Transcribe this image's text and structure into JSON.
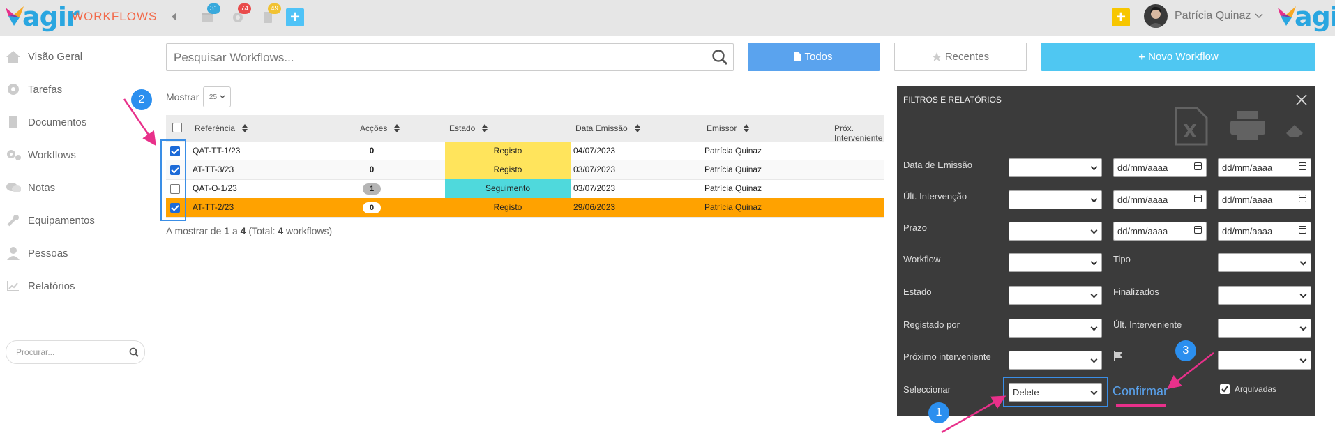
{
  "header": {
    "app_name": "agir",
    "section_title": "WORKFLOWS",
    "badges": {
      "calendar": "31",
      "settings": "74",
      "documents": "49"
    },
    "user_name": "Patrícia Quinaz",
    "colors": {
      "brand": "#2aa6e0",
      "title": "#f26a4b",
      "add_yellow": "#f7c600",
      "add_blue": "#4fc3f7"
    }
  },
  "sidebar": {
    "items": [
      {
        "label": "Visão Geral",
        "icon": "home-icon"
      },
      {
        "label": "Tarefas",
        "icon": "gear-icon"
      },
      {
        "label": "Documentos",
        "icon": "document-icon"
      },
      {
        "label": "Workflows",
        "icon": "gears-icon"
      },
      {
        "label": "Notas",
        "icon": "chat-icon"
      },
      {
        "label": "Equipamentos",
        "icon": "wrench-icon"
      },
      {
        "label": "Pessoas",
        "icon": "user-icon"
      },
      {
        "label": "Relatórios",
        "icon": "chart-icon"
      }
    ],
    "search_placeholder": "Procurar..."
  },
  "toolbar": {
    "search_placeholder": "Pesquisar Workflows...",
    "todos_label": "Todos",
    "recentes_label": "Recentes",
    "novo_label": "Novo Workflow"
  },
  "list": {
    "show_label": "Mostrar",
    "page_size": "25",
    "columns": [
      "Referência",
      "Acções",
      "Estado",
      "Data Emissão",
      "Emissor",
      "Próx. Interveniente"
    ],
    "rows": [
      {
        "ref": "QAT-TT-1/23",
        "accoes": "0",
        "estado": "Registo",
        "data": "04/07/2023",
        "emissor": "Patrícia Quinaz",
        "checked": true
      },
      {
        "ref": "AT-TT-3/23",
        "accoes": "0",
        "estado": "Registo",
        "data": "03/07/2023",
        "emissor": "Patrícia Quinaz",
        "checked": true
      },
      {
        "ref": "QAT-O-1/23",
        "accoes": "1",
        "estado": "Seguimento",
        "data": "03/07/2023",
        "emissor": "Patrícia Quinaz",
        "checked": false
      },
      {
        "ref": "AT-TT-2/23",
        "accoes": "0",
        "estado": "Registo",
        "data": "29/06/2023",
        "emissor": "Patrícia Quinaz",
        "checked": true
      }
    ],
    "info_prefix": "A mostrar de",
    "info_from": "1",
    "info_to_word": "a",
    "info_to": "4",
    "info_total_prefix": "(Total:",
    "info_total": "4",
    "info_total_suffix": "workflows)"
  },
  "filters": {
    "title": "FILTROS E RELATÓRIOS",
    "data_emissao": "Data de Emissão",
    "ult_intervencao": "Últ. Intervenção",
    "prazo": "Prazo",
    "workflow": "Workflow",
    "tipo": "Tipo",
    "estado": "Estado",
    "finalizados": "Finalizados",
    "registado_por": "Registado por",
    "ult_interveniente": "Últ. Interveniente",
    "proximo_interveniente": "Próximo interveniente",
    "seleccionar": "Seleccionar",
    "seleccionar_value": "Delete",
    "confirmar": "Confirmar",
    "arquivadas": "Arquivadas",
    "date_placeholder": "dd/mm/aaaa"
  },
  "annotations": {
    "one": "1",
    "two": "2",
    "three": "3"
  }
}
